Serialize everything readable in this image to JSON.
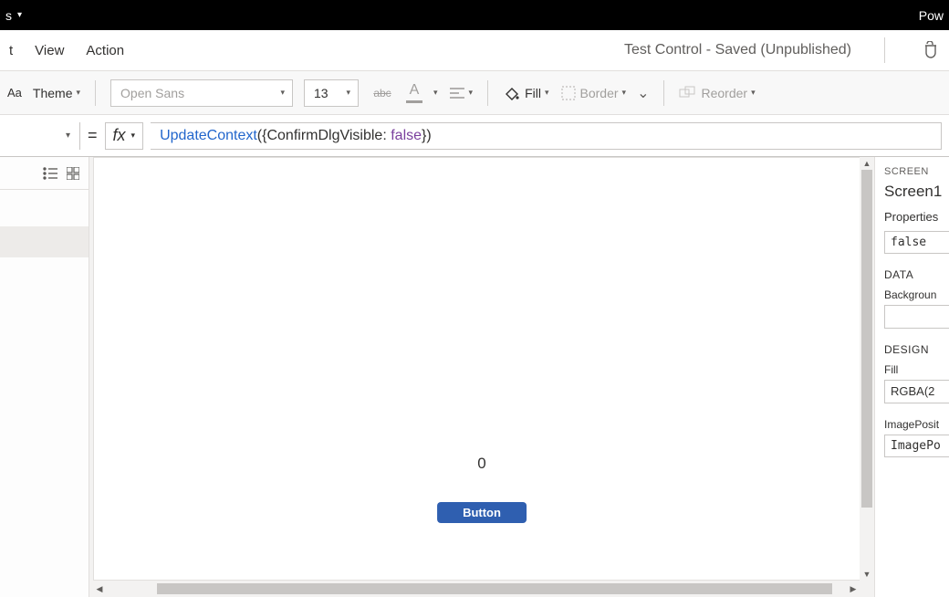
{
  "topbar": {
    "left_suffix": "s",
    "right_text": "Pow"
  },
  "menu": {
    "items": [
      "t",
      "View",
      "Action"
    ],
    "saved_status": "Test Control - Saved (Unpublished)"
  },
  "toolbar": {
    "font_size_label": "Aa",
    "theme_label": "Theme",
    "font_family": "Open Sans",
    "font_size": "13",
    "fill_label": "Fill",
    "border_label": "Border",
    "reorder_label": "Reorder"
  },
  "formula": {
    "eq": "=",
    "fx": "fx",
    "fn": "UpdateContext",
    "open": "({",
    "key": "ConfirmDlgVisible",
    "colon": ": ",
    "val": "false",
    "close": "})"
  },
  "canvas": {
    "counter": "0",
    "button_label": "Button"
  },
  "right": {
    "screen_head": "SCREEN",
    "screen_name": "Screen1",
    "properties_tab": "Properties",
    "visible_value": "false",
    "data_head": "DATA",
    "background_label": "Backgroun",
    "design_head": "DESIGN",
    "fill_label": "Fill",
    "fill_value": "RGBA(2",
    "imageposition_label": "ImagePosit",
    "imageposition_value": "ImagePo"
  }
}
